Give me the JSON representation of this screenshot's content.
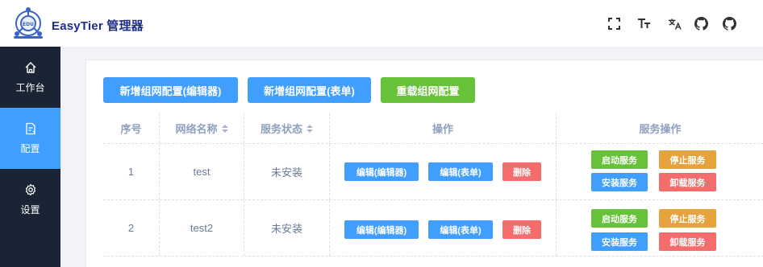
{
  "app": {
    "title": "EasyTier 管理器"
  },
  "header_icons": [
    "fullscreen-icon",
    "font-size-icon",
    "translate-icon",
    "github-icon",
    "github-icon"
  ],
  "sidebar": {
    "items": [
      {
        "label": "工作台",
        "icon": "home-icon",
        "active": false
      },
      {
        "label": "配置",
        "icon": "config-icon",
        "active": true
      },
      {
        "label": "设置",
        "icon": "gear-icon",
        "active": false
      }
    ]
  },
  "toolbar": {
    "new_editor": "新增组网配置(编辑器)",
    "new_form": "新增组网配置(表单)",
    "reload": "重载组网配置"
  },
  "table": {
    "headers": {
      "index": "序号",
      "name": "网络名称",
      "status": "服务状态",
      "actions": "操作",
      "service_actions": "服务操作"
    },
    "rows": [
      {
        "index": "1",
        "name": "test",
        "status": "未安装"
      },
      {
        "index": "2",
        "name": "test2",
        "status": "未安装"
      }
    ],
    "row_actions": {
      "edit_editor": "编辑(编辑器)",
      "edit_form": "编辑(表单)",
      "delete": "删除"
    },
    "service_actions": {
      "start": "启动服务",
      "stop": "停止服务",
      "install": "安装服务",
      "uninstall": "卸载服务"
    }
  },
  "colors": {
    "primary": "#409eff",
    "success": "#67c23a",
    "warning": "#e6a23c",
    "danger": "#f56c6c",
    "sidebar": "#1a2435"
  }
}
